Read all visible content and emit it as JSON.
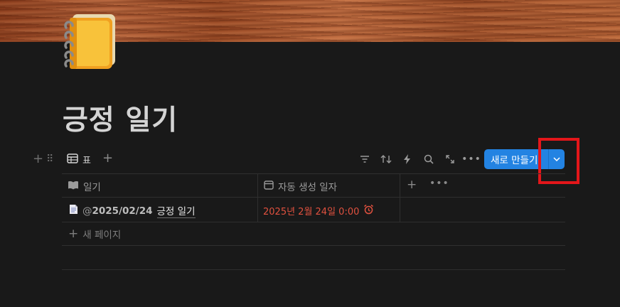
{
  "page": {
    "title": "긍정 일기",
    "icon": "notebook-icon"
  },
  "view": {
    "tab_label": "표",
    "tab_icon": "table-icon"
  },
  "toolbar": {
    "new_button_label": "새로 만들기",
    "icons": [
      "filter-icon",
      "sort-icon",
      "automation-icon",
      "search-icon",
      "expand-icon",
      "more-icon"
    ]
  },
  "table": {
    "columns": [
      {
        "label": "일기",
        "icon": "book-icon"
      },
      {
        "label": "자동 생성 일자",
        "icon": "calendar-icon"
      }
    ],
    "rows": [
      {
        "mention_prefix": "@",
        "mention_date": "2025/02/24",
        "title": "긍정 일기",
        "created": "2025년 2월 24일 0:00"
      }
    ],
    "new_page_label": "새 페이지"
  },
  "colors": {
    "accent": "#2383e2",
    "highlight": "#e3161a",
    "date_text": "#e0513f",
    "background": "#191919"
  }
}
